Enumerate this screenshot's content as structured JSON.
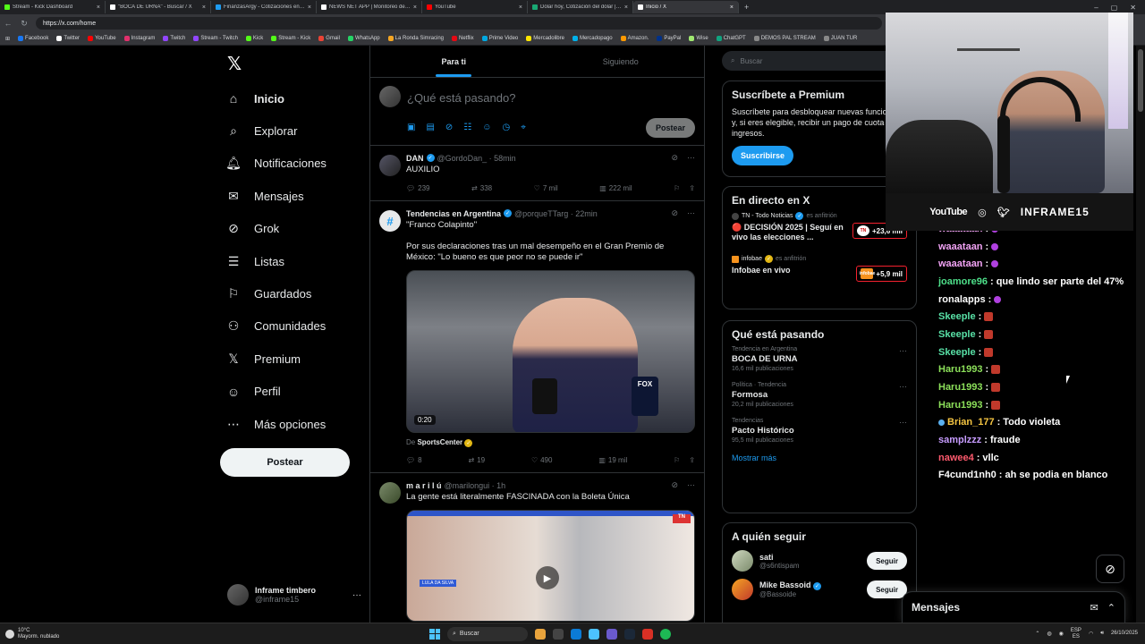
{
  "browser": {
    "tabs": [
      {
        "label": "Stream - Kick Dashboard",
        "color": "#53fc18"
      },
      {
        "label": "\"BOCA DE URNA\" - Buscar / X",
        "color": "#ffffff"
      },
      {
        "label": "FinanzasArgy - Cotizaciones en ti...",
        "color": "#1d9bf0"
      },
      {
        "label": "NEWS NET APP | Monitoreo de m...",
        "color": "#ffffff"
      },
      {
        "label": "YouTube",
        "color": "#ff0000"
      },
      {
        "label": "Dólar hoy, Cotización del dólar | ...",
        "color": "#19a974"
      },
      {
        "label": "Inicio / X",
        "color": "#ffffff",
        "active": true
      }
    ],
    "url": "https://x.com/home",
    "bookmarks": [
      "Facebook",
      "Twitter",
      "YouTube",
      "Instagram",
      "Twitch",
      "Stream - Twitch",
      "Kick",
      "Stream - Kick",
      "Gmail",
      "WhatsApp",
      "La Ronda Simracing",
      "Netflix",
      "Prime Video",
      "Mercadolibre",
      "Mercadopago",
      "Amazon.",
      "PayPal",
      "Wise",
      "ChatGPT",
      "DEMOS PAL STREAM",
      "JUAN TUR"
    ]
  },
  "nav": {
    "items": [
      {
        "label": "Inicio",
        "icon": "home-icon",
        "glyph": "⌂",
        "active": true
      },
      {
        "label": "Explorar",
        "icon": "search-icon",
        "glyph": "⌕"
      },
      {
        "label": "Notificaciones",
        "icon": "bell-icon",
        "glyph": "🔔︎"
      },
      {
        "label": "Mensajes",
        "icon": "mail-icon",
        "glyph": "✉"
      },
      {
        "label": "Grok",
        "icon": "grok-icon",
        "glyph": "⊘"
      },
      {
        "label": "Listas",
        "icon": "list-icon",
        "glyph": "☰"
      },
      {
        "label": "Guardados",
        "icon": "bookmark-icon",
        "glyph": "⚐"
      },
      {
        "label": "Comunidades",
        "icon": "communities-icon",
        "glyph": "⚇"
      },
      {
        "label": "Premium",
        "icon": "x-logo-icon",
        "glyph": "𝕏"
      },
      {
        "label": "Perfil",
        "icon": "profile-icon",
        "glyph": "☺"
      },
      {
        "label": "Más opciones",
        "icon": "more-icon",
        "glyph": "⋯"
      }
    ],
    "post_label": "Postear",
    "account": {
      "name": "Inframe timbero",
      "handle": "@inframe15"
    }
  },
  "timeline": {
    "tab_for_you": "Para ti",
    "tab_following": "Siguiendo",
    "composer_placeholder": "¿Qué está pasando?",
    "composer_post": "Postear",
    "tweets": [
      {
        "name": "DAN",
        "handle": "@GordoDan_ · 58min",
        "text": "AUXILIO",
        "replies": "239",
        "reposts": "338",
        "likes": "7 mil",
        "views": "222 mil"
      },
      {
        "name": "Tendencias en Argentina",
        "handle": "@porqueTTarg · 22min",
        "text": "\"Franco Colapinto\"",
        "text2": "Por sus declaraciones tras un mal desempeño en el Gran Premio de México: \"Lo bueno es que peor no se puede ir\"",
        "video_time": "0:20",
        "source_prefix": "De",
        "source_name": "SportsCenter",
        "replies": "8",
        "reposts": "19",
        "likes": "490",
        "views": "19 mil"
      },
      {
        "name": "m a r i l ú",
        "handle": "@marilongui · 1h",
        "text": "La gente está literalmente FASCINADA con la Boleta Única"
      }
    ]
  },
  "sidebar": {
    "search_placeholder": "Buscar",
    "premium": {
      "title": "Suscríbete a Premium",
      "body": "Suscríbete para desbloquear nuevas funciones y, si eres elegible, recibir un pago de cuota de ingresos.",
      "button": "Suscribirse"
    },
    "live": {
      "title": "En directo en X",
      "items": [
        {
          "host": "TN - Todo Noticias",
          "host_suffix": "es anfitrión",
          "title": "🔴 DECISIÓN 2025 | Seguí en vivo las elecciones ...",
          "count": "+23,6 mil",
          "badge": "TN"
        },
        {
          "host": "infobae",
          "host_suffix": "es anfitrión",
          "title": "Infobae en vivo",
          "count": "+5,9 mil",
          "badge": "infobae"
        }
      ]
    },
    "trends": {
      "title": "Qué está pasando",
      "items": [
        {
          "category": "Tendencia en Argentina",
          "topic": "BOCA DE URNA",
          "count": "16,6 mil publicaciones"
        },
        {
          "category": "Política · Tendencia",
          "topic": "Formosa",
          "count": "20,2 mil publicaciones"
        },
        {
          "category": "Tendencias",
          "topic": "Pacto Histórico",
          "count": "95,5 mil publicaciones"
        }
      ],
      "show_more": "Mostrar más"
    },
    "follow": {
      "title": "A quién seguir",
      "items": [
        {
          "name": "sati",
          "handle": "@s6ntispam",
          "button": "Seguir"
        },
        {
          "name": "Mike Bassoid",
          "handle": "@Bassoide",
          "button": "Seguir"
        }
      ]
    }
  },
  "stream": {
    "socials": [
      "YouTube",
      "INFRAME15"
    ],
    "chat": [
      {
        "user": "waaataan",
        "color": "#f2a3f5",
        "msg": "",
        "emote": "purple"
      },
      {
        "user": "waaataan",
        "color": "#f2a3f5",
        "msg": "",
        "emote": "purple"
      },
      {
        "user": "waaataan",
        "color": "#f2a3f5",
        "msg": "",
        "emote": "purple"
      },
      {
        "user": "joamore96",
        "color": "#4ee08a",
        "msg": "que lindo ser parte del 47%"
      },
      {
        "user": "ronalapps",
        "color": "#ffffff",
        "msg": "",
        "emote": "purple"
      },
      {
        "user": "Skeeple",
        "color": "#58e0a6",
        "msg": "",
        "emote": "red"
      },
      {
        "user": "Skeeple",
        "color": "#58e0a6",
        "msg": "",
        "emote": "red"
      },
      {
        "user": "Skeeple",
        "color": "#58e0a6",
        "msg": "",
        "emote": "red"
      },
      {
        "user": "Haru1993",
        "color": "#8ce05a",
        "msg": "",
        "emote": "red"
      },
      {
        "user": "Haru1993",
        "color": "#8ce05a",
        "msg": "",
        "emote": "red"
      },
      {
        "user": "Haru1993",
        "color": "#8ce05a",
        "msg": "",
        "emote": "red"
      },
      {
        "user": "Brian_177",
        "color": "#f5c542",
        "msg": "Todo violeta",
        "badge": true
      },
      {
        "user": "samplzzz",
        "color": "#c79cff",
        "msg": "fraude"
      },
      {
        "user": "nawee4",
        "color": "#ff5a6e",
        "msg": "vllc"
      },
      {
        "user": "F4cund1nh0",
        "color": "#ffffff",
        "msg": "ah se podia en blanco"
      }
    ]
  },
  "messages_drawer": {
    "title": "Mensajes"
  },
  "taskbar": {
    "temp": "10°C",
    "weather": "Mayorm. nublado",
    "search": "Buscar",
    "lang_top": "ESP",
    "lang_bottom": "ES",
    "date": "26/10/2025"
  }
}
